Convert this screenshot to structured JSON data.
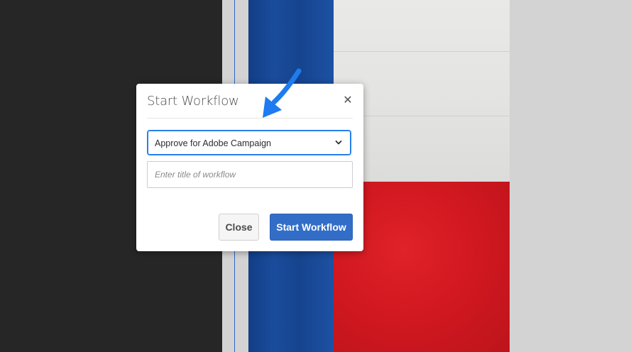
{
  "dialog": {
    "title": "Start Workflow",
    "close_icon": "close-icon",
    "workflow_select": {
      "selected_value": "Approve for Adobe Campaign",
      "icon": "chevron-down-icon"
    },
    "title_input": {
      "value": "",
      "placeholder": "Enter title of workflow"
    },
    "buttons": {
      "close_label": "Close",
      "start_label": "Start Workflow"
    }
  },
  "annotation": {
    "icon": "pointer-arrow-icon",
    "color": "#1e7cf0"
  },
  "colors": {
    "accent": "#326ec8",
    "focus_border": "#2680eb",
    "dark_panel": "#262626"
  }
}
